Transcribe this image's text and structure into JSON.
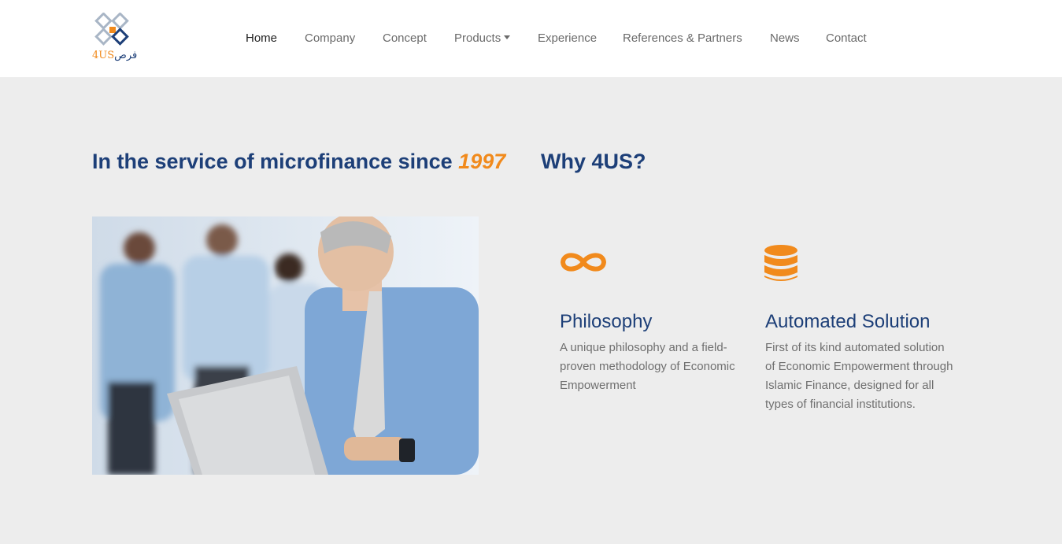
{
  "brand": {
    "logo_number": "4US",
    "logo_arabic": "فرص"
  },
  "nav": {
    "items": [
      {
        "label": "Home"
      },
      {
        "label": "Company"
      },
      {
        "label": "Concept"
      },
      {
        "label": "Products"
      },
      {
        "label": "Experience"
      },
      {
        "label": "References & Partners"
      },
      {
        "label": "News"
      },
      {
        "label": "Contact"
      }
    ]
  },
  "hero": {
    "left_heading": "In the service of microfinance since ",
    "left_heading_year": "1997",
    "right_heading": "Why 4US?"
  },
  "features": [
    {
      "icon": "infinity-icon",
      "title": "Philosophy",
      "text": "A unique philosophy and a field-proven methodology of Economic Empowerment"
    },
    {
      "icon": "database-icon",
      "title": "Automated Solution",
      "text": "First of its kind automated solution of Economic Empowerment through Islamic Finance, designed for all types of financial institutions."
    }
  ],
  "colors": {
    "accent": "#f18a1c",
    "brand": "#1d3f78",
    "background": "#ededed"
  }
}
